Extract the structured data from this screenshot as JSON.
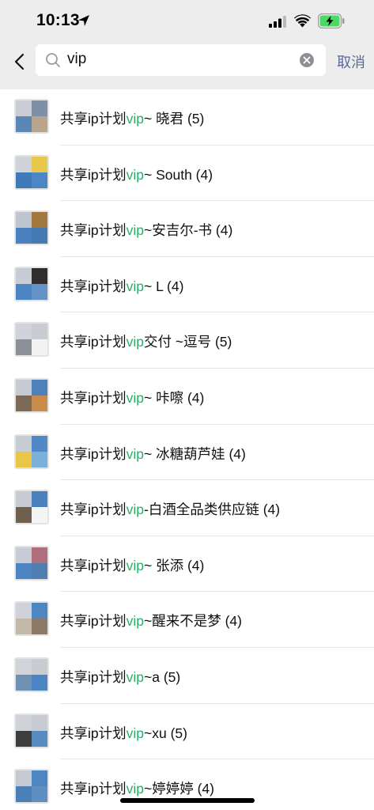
{
  "status_bar": {
    "time": "10:13",
    "icons": [
      "location-arrow-icon",
      "cell-signal-icon",
      "wifi-icon",
      "battery-charging-icon"
    ],
    "battery_color": "#4cd964"
  },
  "search": {
    "query": "vip",
    "cancel_label": "取消"
  },
  "colors": {
    "highlight": "#2aae67",
    "cancel": "#576b95",
    "header_bg": "#ededed"
  },
  "results": [
    {
      "prefix": "共享ip计划",
      "match": "vip",
      "suffix": "~ 晓君 (5)",
      "avatar_tiles": [
        "#c9cdd6",
        "#7f8fa6",
        "#5b87b5",
        "#b9a58c"
      ]
    },
    {
      "prefix": "共享ip计划",
      "match": "vip",
      "suffix": "~ South (4)",
      "avatar_tiles": [
        "#cfd3da",
        "#e8c84a",
        "#3f79b8",
        "#4d86c4"
      ]
    },
    {
      "prefix": "共享ip计划",
      "match": "vip",
      "suffix": "~安吉尔-书 (4)",
      "avatar_tiles": [
        "#bfc5cf",
        "#a3783f",
        "#4a80bd",
        "#4679b2"
      ]
    },
    {
      "prefix": "共享ip计划",
      "match": "vip",
      "suffix": "~ L (4)",
      "avatar_tiles": [
        "#c8ccd4",
        "#2e2e2e",
        "#4b84c2",
        "#6592c4"
      ]
    },
    {
      "prefix": "共享ip计划",
      "match": "vip",
      "suffix": "交付 ~逗号 (5)",
      "avatar_tiles": [
        "#d0d3d9",
        "#c9ccd2",
        "#8b8f97",
        "#f2f2f2"
      ]
    },
    {
      "prefix": "共享ip计划",
      "match": "vip",
      "suffix": "~ 咔嚓 (4)",
      "avatar_tiles": [
        "#c6cbd3",
        "#4d82bd",
        "#7a6a55",
        "#c98a4a"
      ]
    },
    {
      "prefix": "共享ip计划",
      "match": "vip",
      "suffix": "~ 冰糖葫芦娃 (4)",
      "avatar_tiles": [
        "#c8ccd3",
        "#5089c6",
        "#e9c548",
        "#7db0d8"
      ]
    },
    {
      "prefix": "共享ip计划",
      "match": "vip",
      "suffix": "-白酒全品类供应链 (4)",
      "avatar_tiles": [
        "#c7cbd2",
        "#4a80bd",
        "#6f5f4d",
        "#f4f4f4"
      ]
    },
    {
      "prefix": "共享ip计划",
      "match": "vip",
      "suffix": "~ 张添 (4)",
      "avatar_tiles": [
        "#c7cbd3",
        "#b06f7d",
        "#4c85c2",
        "#4f7fb0"
      ]
    },
    {
      "prefix": "共享ip计划",
      "match": "vip",
      "suffix": "~醒来不是梦 (4)",
      "avatar_tiles": [
        "#cfd2d8",
        "#4d86c3",
        "#c2b9a8",
        "#8d7a66"
      ]
    },
    {
      "prefix": "共享ip计划",
      "match": "vip",
      "suffix": "~a (5)",
      "avatar_tiles": [
        "#d1d4da",
        "#c9ccd2",
        "#6f8fb3",
        "#4b84c2"
      ]
    },
    {
      "prefix": "共享ip计划",
      "match": "vip",
      "suffix": "~xu (5)",
      "avatar_tiles": [
        "#cfd2d8",
        "#c9ccd2",
        "#3d3d3d",
        "#5a8bc0"
      ]
    },
    {
      "prefix": "共享ip计划",
      "match": "vip",
      "suffix": "~婷婷婷 (4)",
      "avatar_tiles": [
        "#c5c9d1",
        "#4d86c3",
        "#4a7fb8",
        "#5e8fc0"
      ]
    }
  ]
}
